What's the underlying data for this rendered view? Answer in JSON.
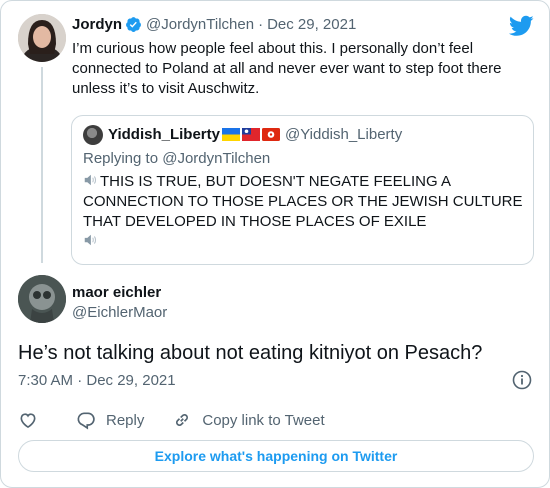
{
  "colors": {
    "link": "#1d9bf0",
    "muted": "#536471",
    "text": "#0f1419",
    "border": "#cfd9de"
  },
  "parent_tweet": {
    "name": "Jordyn",
    "handle": "@JordynTilchen",
    "separator": "·",
    "date": "Dec 29, 2021",
    "text": "I’m curious how people feel about this. I personally don’t feel connected to Poland at all and never ever want to step foot there unless it’s to visit Auschwitz."
  },
  "quoted_tweet": {
    "name": "Yiddish_Liberty",
    "flags": [
      "ukraine-flag",
      "taiwan-flag",
      "hong-kong-flag"
    ],
    "handle": "@Yiddish_Liberty",
    "replying_to": "Replying to @JordynTilchen",
    "text": "THIS IS TRUE, BUT DOESN'T NEGATE FEELING A CONNECTION TO THOSE PLACES OR THE JEWISH CULTURE THAT DEVELOPED IN THOSE PLACES OF EXILE"
  },
  "main_tweet": {
    "name": "maor eichler",
    "handle": "@EichlerMaor",
    "text": "He’s not talking about not eating kitniyot on Pesach?",
    "timestamp": "7:30 AM · Dec 29, 2021"
  },
  "actions": {
    "like_icon": "heart-icon",
    "reply_label": "Reply",
    "copy_link_label": "Copy link to Tweet"
  },
  "explore_label": "Explore what's happening on Twitter"
}
